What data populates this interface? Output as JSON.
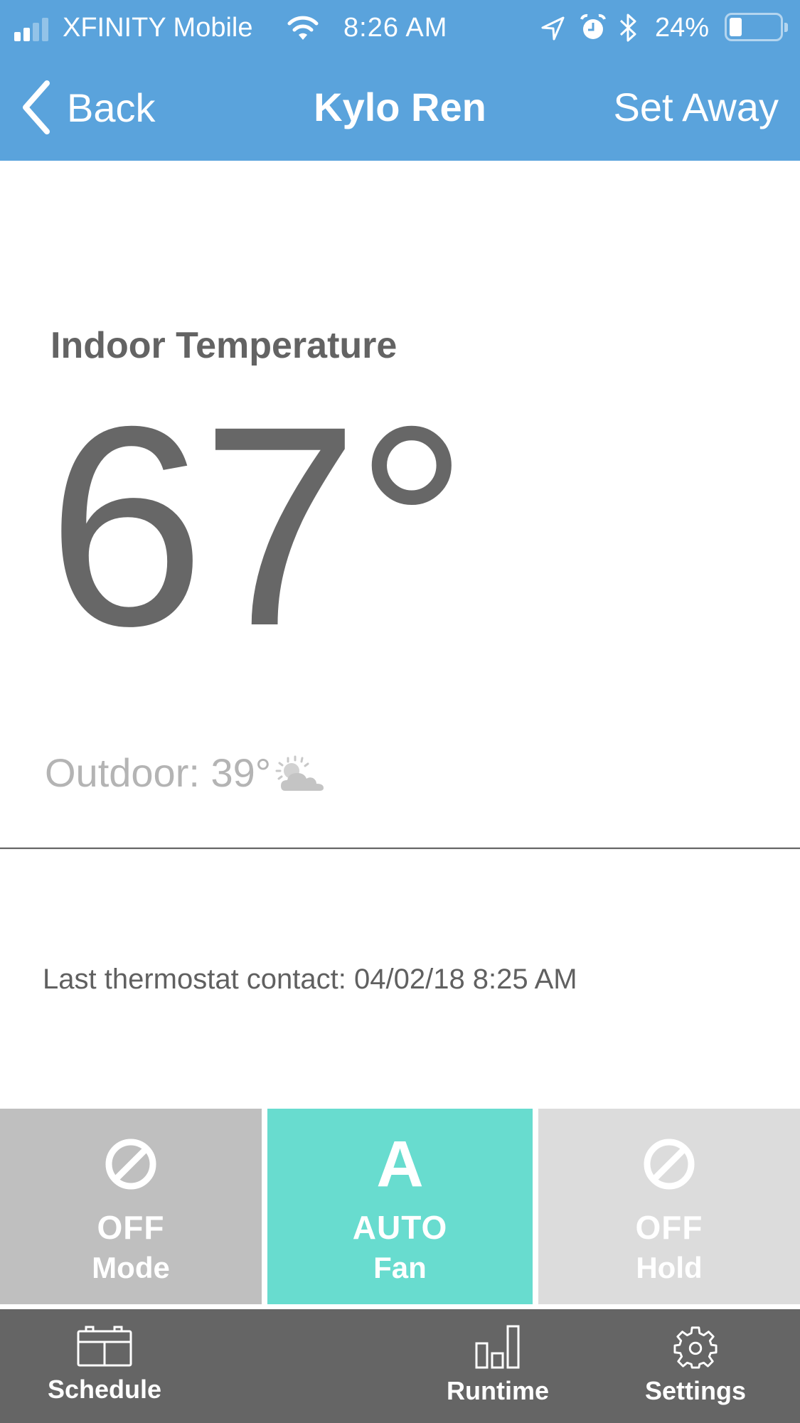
{
  "status_bar": {
    "carrier": "XFINITY Mobile",
    "time": "8:26 AM",
    "battery_percent": "24%",
    "battery_level": 0.24,
    "signal_bars_filled": 2,
    "signal_bars_total": 4,
    "icons": [
      "signal-icon",
      "wifi-icon",
      "location-icon",
      "alarm-icon",
      "bluetooth-icon",
      "battery-icon"
    ]
  },
  "nav": {
    "back_label": "Back",
    "title": "Kylo Ren",
    "action_label": "Set Away"
  },
  "indoor": {
    "label": "Indoor Temperature",
    "temperature": "67°"
  },
  "outdoor": {
    "text": "Outdoor: 39°",
    "weather_icon": "partly-cloudy-icon"
  },
  "last_contact": "Last thermostat contact: 04/02/18 8:25 AM",
  "modes": [
    {
      "value": "OFF",
      "name": "Mode",
      "icon": "off-icon",
      "color": "#bfbfbf"
    },
    {
      "value": "AUTO",
      "name": "Fan",
      "icon": "auto-icon",
      "glyph": "A",
      "color": "#68dccf"
    },
    {
      "value": "OFF",
      "name": "Hold",
      "icon": "off-icon",
      "color": "#dcdcdc"
    }
  ],
  "tabs": [
    {
      "label": "Schedule",
      "icon": "calendar-icon"
    },
    {
      "label": "Runtime",
      "icon": "bar-chart-icon"
    },
    {
      "label": "Settings",
      "icon": "gear-icon"
    }
  ],
  "colors": {
    "header_blue": "#5aa3dc",
    "fan_active": "#68dccf",
    "tab_bar": "#656565",
    "temp_text": "#676767"
  }
}
